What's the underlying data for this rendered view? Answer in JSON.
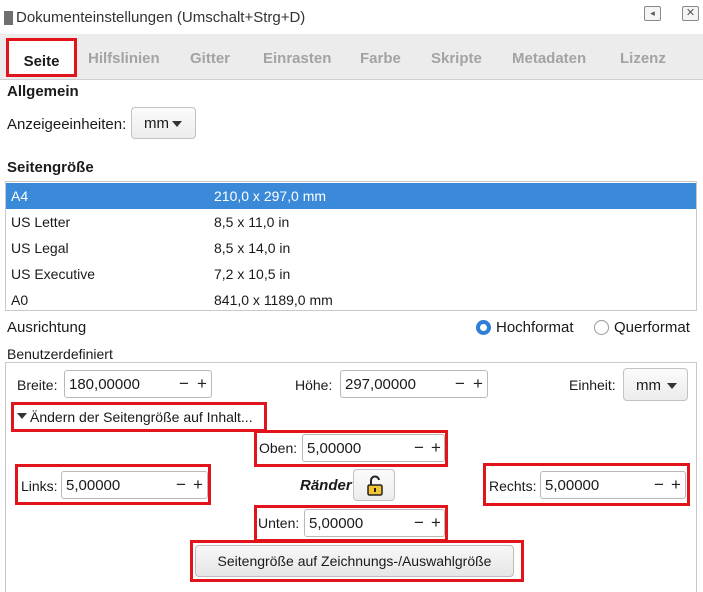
{
  "window": {
    "title": "Dokumenteinstellungen (Umschalt+Strg+D)",
    "shade_icon": "◂",
    "close_icon": "✕"
  },
  "tabs": [
    "Seite",
    "Hilfslinien",
    "Gitter",
    "Einrasten",
    "Farbe",
    "Skripte",
    "Metadaten",
    "Lizenz"
  ],
  "general": {
    "heading": "Allgemein",
    "display_units_label": "Anzeigeeinheiten:",
    "display_units_value": "mm"
  },
  "page_size": {
    "heading": "Seitengröße",
    "rows": [
      {
        "name": "A4",
        "size": "210,0 x 297,0 mm",
        "selected": true
      },
      {
        "name": "US Letter",
        "size": "8,5 x 11,0 in"
      },
      {
        "name": "US Legal",
        "size": "8,5 x 14,0 in"
      },
      {
        "name": "US Executive",
        "size": "7,2 x 10,5 in"
      },
      {
        "name": "A0",
        "size": "841,0 x 1189,0 mm"
      }
    ]
  },
  "orientation": {
    "label": "Ausrichtung",
    "portrait": "Hochformat",
    "landscape": "Querformat",
    "selected": "portrait"
  },
  "custom": {
    "legend": "Benutzerdefiniert",
    "width_label": "Breite:",
    "width_value": "180,00000",
    "height_label": "Höhe:",
    "height_value": "297,00000",
    "unit_label": "Einheit:",
    "unit_value": "mm",
    "expander_label": "Ändern der Seitengröße auf Inhalt...",
    "margins_label": "Ränder",
    "top_label": "Oben:",
    "top_value": "5,00000",
    "left_label": "Links:",
    "left_value": "5,00000",
    "right_label": "Rechts:",
    "right_value": "5,00000",
    "bottom_label": "Unten:",
    "bottom_value": "5,00000",
    "fit_button": "Seitengröße auf Zeichnungs-/Auswahlgröße"
  },
  "colors": {
    "selection": "#3b8ad9",
    "highlight": "#e0141a",
    "radio_on": "#2f7fd6"
  }
}
